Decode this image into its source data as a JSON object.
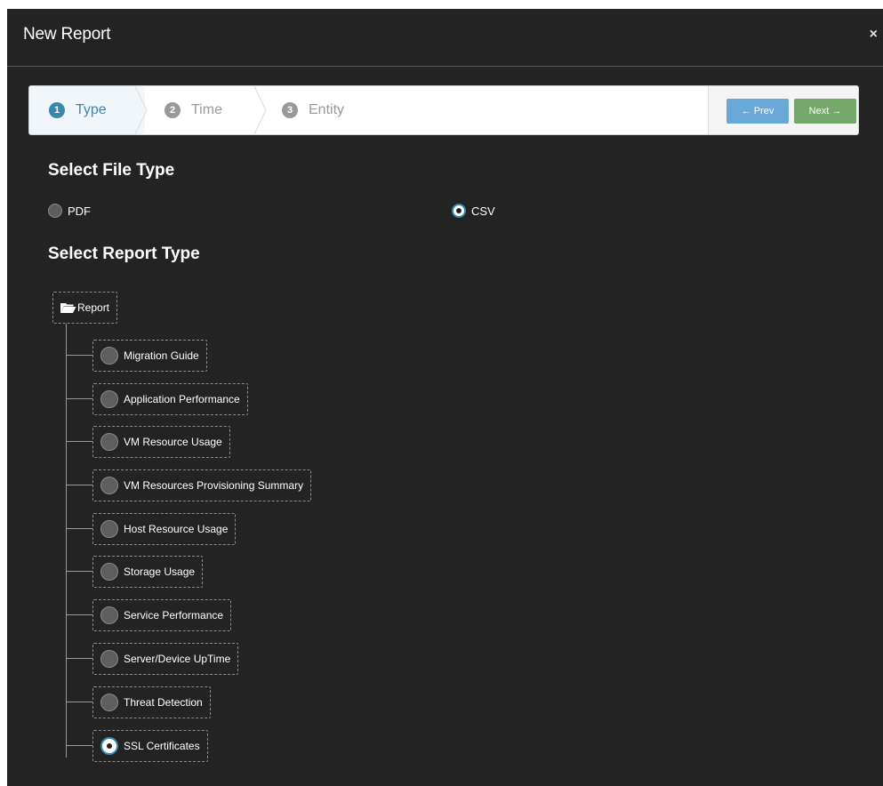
{
  "modal": {
    "title": "New Report",
    "close_label": "×"
  },
  "wizard": {
    "steps": [
      {
        "number": "1",
        "label": "Type",
        "active": true
      },
      {
        "number": "2",
        "label": "Time",
        "active": false
      },
      {
        "number": "3",
        "label": "Entity",
        "active": false
      }
    ],
    "prev_label": "← Prev",
    "next_label": "Next →"
  },
  "file_type": {
    "heading": "Select File Type",
    "options": [
      {
        "label": "PDF",
        "selected": false
      },
      {
        "label": "CSV",
        "selected": true
      }
    ]
  },
  "report_type": {
    "heading": "Select Report Type",
    "root_label": "Report",
    "root_icon": "folder-open-icon",
    "items": [
      {
        "label": "Migration Guide",
        "selected": false
      },
      {
        "label": "Application Performance",
        "selected": false
      },
      {
        "label": "VM Resource Usage",
        "selected": false
      },
      {
        "label": "VM Resources Provisioning Summary",
        "selected": false
      },
      {
        "label": "Host Resource Usage",
        "selected": false
      },
      {
        "label": "Storage Usage",
        "selected": false
      },
      {
        "label": "Service Performance",
        "selected": false
      },
      {
        "label": "Server/Device UpTime",
        "selected": false
      },
      {
        "label": "Threat Detection",
        "selected": false
      },
      {
        "label": "SSL Certificates",
        "selected": true
      }
    ]
  },
  "colors": {
    "background": "#232323",
    "accent": "#3a87ad",
    "prev_button": "#6aa8d8",
    "next_button": "#75a86a"
  }
}
